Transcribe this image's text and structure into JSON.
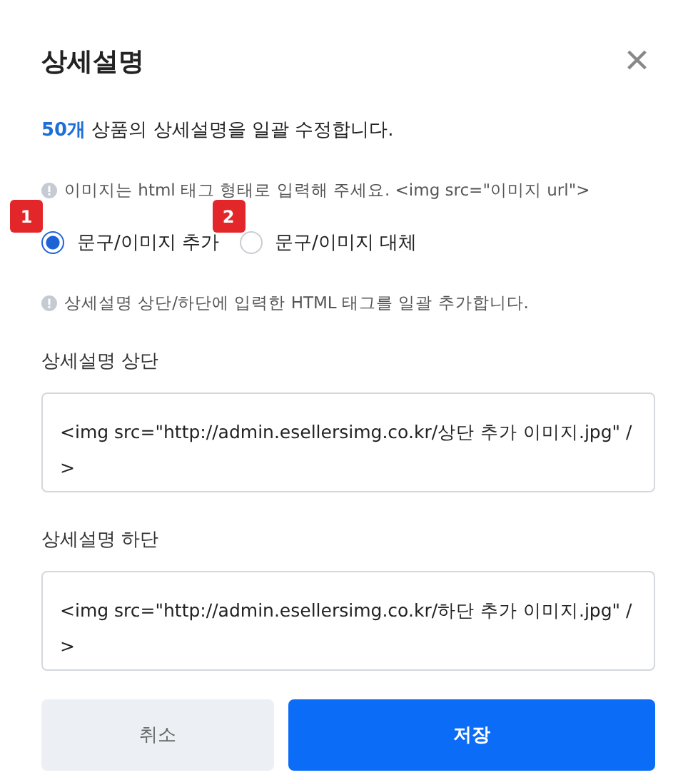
{
  "dialog": {
    "title": "상세설명",
    "close": "×"
  },
  "summary": {
    "count": "50개",
    "text": " 상품의 상세설명을 일괄 수정합니다."
  },
  "notice_image": "이미지는 html 태그 형태로 입력해 주세요. <img src=\"이미지 url\">",
  "options": [
    {
      "label": "문구/이미지 추가",
      "selected": true,
      "badge": "1"
    },
    {
      "label": "문구/이미지 대체",
      "selected": false,
      "badge": "2"
    }
  ],
  "notice_html": "상세설명 상단/하단에 입력한 HTML 태그를 일괄 추가합니다.",
  "fields": [
    {
      "label": "상세설명 상단",
      "value": "<img src=\"http://admin.esellersimg.co.kr/상단 추가 이미지.jpg\" />"
    },
    {
      "label": "상세설명 하단",
      "value": "<img src=\"http://admin.esellersimg.co.kr/하단 추가 이미지.jpg\" />"
    }
  ],
  "buttons": [
    {
      "label": "취소",
      "kind": "secondary"
    },
    {
      "label": "저장",
      "kind": "primary"
    }
  ]
}
